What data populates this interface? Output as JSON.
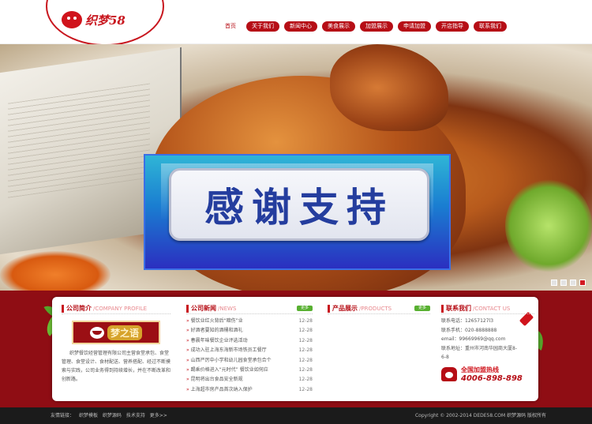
{
  "header": {
    "logo_text": "织梦58",
    "nav": [
      "首页",
      "关于我们",
      "新闻中心",
      "美食展示",
      "加盟展示",
      "申请加盟",
      "开店指导",
      "联系我们"
    ]
  },
  "banner": {
    "overlay_text": "感谢支持",
    "slide_count": 4,
    "active_slide": 4
  },
  "intro": {
    "title": "公司简介",
    "title_en": "/COMPANY PROFILE",
    "logo_text": "梦之语",
    "text": "织梦餐饮经营管理有限公司主营食堂承包、食堂管理、食堂设计、食材配送、营养搭配、经过不断摸索与实践，公司业务得到持续增长，并在不断改革和创新路。"
  },
  "news": {
    "title": "公司新闻",
    "title_en": "/NEWS",
    "more_label": "更多",
    "items": [
      {
        "title": "餐饮业红火背后“暗伤”业",
        "date": "12-28"
      },
      {
        "title": "好酒者要知的酒桶和酒礼",
        "date": "12-28"
      },
      {
        "title": "春晨年味餐饮企业评选活动",
        "date": "12-28"
      },
      {
        "title": "成功入驻上海东海新市场铁员工餐厅",
        "date": "12-28"
      },
      {
        "title": "山西严厉中小学和幼儿园食堂承包合个",
        "date": "12-28"
      },
      {
        "title": "踢乘价格进入“元时代” 餐饮业如何应",
        "date": "12-28"
      },
      {
        "title": "昆明将出台食品安全新规",
        "date": "12-28"
      },
      {
        "title": "上海超市房产品首次纳入保护",
        "date": "12-28"
      }
    ]
  },
  "products": {
    "title": "产品展示",
    "title_en": "/PRODUCTS",
    "more_label": "更多"
  },
  "contact": {
    "title": "联系我们",
    "title_en": "/CONTACT US",
    "lines": [
      "联系电话：12657127l3",
      "联系手机：020-8888888",
      "email：99669969@qq.com",
      "联系地址：重州市河南华园商大厦8-",
      "6-8"
    ],
    "hotline_label": "全国加盟热线",
    "hotline_number": "4006-898-898"
  },
  "footer": {
    "links": [
      "友情链接：",
      "织梦模板",
      "织梦源码",
      "技术支持",
      "更多>>"
    ],
    "copyright": "Copyright © 2002-2014 DEDE58.COM 织梦源码 版权所有"
  }
}
